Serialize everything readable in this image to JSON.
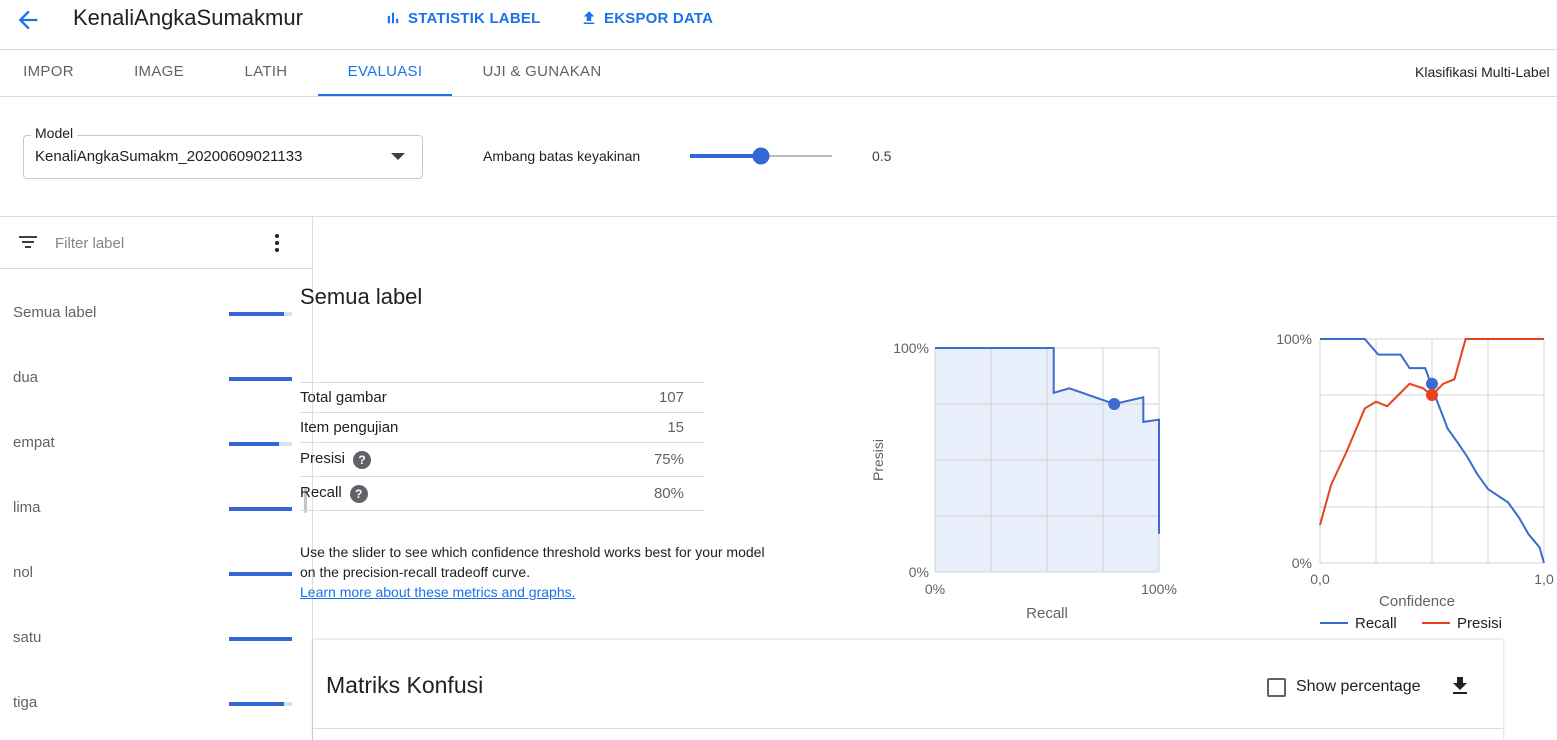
{
  "header": {
    "title": "KenaliAngkaSumakmur",
    "actions": [
      {
        "label": "STATISTIK LABEL",
        "icon": "bar-chart-icon"
      },
      {
        "label": "EKSPOR DATA",
        "icon": "export-icon"
      }
    ]
  },
  "tabs": [
    {
      "label": "IMPOR",
      "active": false
    },
    {
      "label": "IMAGE",
      "active": false
    },
    {
      "label": "LATIH",
      "active": false
    },
    {
      "label": "EVALUASI",
      "active": true
    },
    {
      "label": "UJI & GUNAKAN",
      "active": false
    }
  ],
  "tab_right_text": "Klasifikasi Multi-Label",
  "model": {
    "label": "Model",
    "value": "KenaliAngkaSumakm_20200609021133"
  },
  "threshold": {
    "label": "Ambang batas keyakinan",
    "value": "0.5",
    "fraction": 0.5
  },
  "filter": {
    "placeholder": "Filter label"
  },
  "labels": [
    {
      "name": "Semua label",
      "fill": 0.88
    },
    {
      "name": "dua",
      "fill": 1.0
    },
    {
      "name": "empat",
      "fill": 0.8
    },
    {
      "name": "lima",
      "fill": 1.0
    },
    {
      "name": "nol",
      "fill": 1.0
    },
    {
      "name": "satu",
      "fill": 1.0
    },
    {
      "name": "tiga",
      "fill": 0.88
    }
  ],
  "section": {
    "title": "Semua label",
    "metrics": [
      {
        "key": "Total gambar",
        "value": "107",
        "help": false
      },
      {
        "key": "Item pengujian",
        "value": "15",
        "help": false
      },
      {
        "key": "Presisi",
        "value": "75%",
        "help": true
      },
      {
        "key": "Recall",
        "value": "80%",
        "help": true
      }
    ],
    "help_text": "Use the slider to see which confidence threshold works best for your model on the precision-recall tradeoff curve.",
    "learn_more": "Learn more about these metrics and graphs."
  },
  "colors": {
    "accent": "#1a73e8",
    "recall": "#3c6bd0",
    "presisi": "#e8421a",
    "bar": "#3367d6"
  },
  "chart_data": [
    {
      "type": "area",
      "xlabel": "Recall",
      "ylabel": "Presisi",
      "xlim": [
        0,
        1
      ],
      "ylim": [
        0,
        1
      ],
      "x_ticks": [
        "0%",
        "100%"
      ],
      "y_ticks": [
        "0%",
        "100%"
      ],
      "grid": true,
      "series": [
        {
          "x": [
            0,
            0.53,
            0.53,
            0.6,
            0.8,
            0.93,
            0.93,
            1.0,
            1.0
          ],
          "y": [
            1,
            1,
            0.8,
            0.82,
            0.75,
            0.78,
            0.67,
            0.68,
            0.17
          ]
        }
      ],
      "marker": {
        "x": 0.8,
        "y": 0.75
      }
    },
    {
      "type": "line",
      "xlabel": "Confidence",
      "xlim": [
        0,
        1
      ],
      "ylim": [
        0,
        1
      ],
      "x_ticks": [
        "0,0",
        "1,0"
      ],
      "y_ticks": [
        "0%",
        "100%"
      ],
      "grid": true,
      "series": [
        {
          "name": "Recall",
          "x": [
            0,
            0.2,
            0.26,
            0.36,
            0.4,
            0.47,
            0.52,
            0.57,
            0.62,
            0.66,
            0.7,
            0.75,
            0.84,
            0.89,
            0.93,
            0.98,
            1.0
          ],
          "y": [
            1,
            1,
            0.93,
            0.93,
            0.87,
            0.87,
            0.73,
            0.6,
            0.53,
            0.47,
            0.4,
            0.33,
            0.27,
            0.2,
            0.13,
            0.07,
            0
          ]
        },
        {
          "name": "Presisi",
          "x": [
            0,
            0.05,
            0.12,
            0.2,
            0.25,
            0.3,
            0.35,
            0.4,
            0.46,
            0.5,
            0.55,
            0.6,
            0.65,
            1.0
          ],
          "y": [
            0.17,
            0.35,
            0.5,
            0.69,
            0.72,
            0.7,
            0.75,
            0.8,
            0.78,
            0.75,
            0.8,
            0.82,
            1,
            1
          ]
        }
      ],
      "markers": [
        {
          "series": "Recall",
          "x": 0.5,
          "y": 0.8
        },
        {
          "series": "Presisi",
          "x": 0.5,
          "y": 0.75
        }
      ],
      "legend_position": "bottom"
    }
  ],
  "confusion": {
    "title": "Matriks Konfusi",
    "checkbox_label": "Show percentage"
  }
}
